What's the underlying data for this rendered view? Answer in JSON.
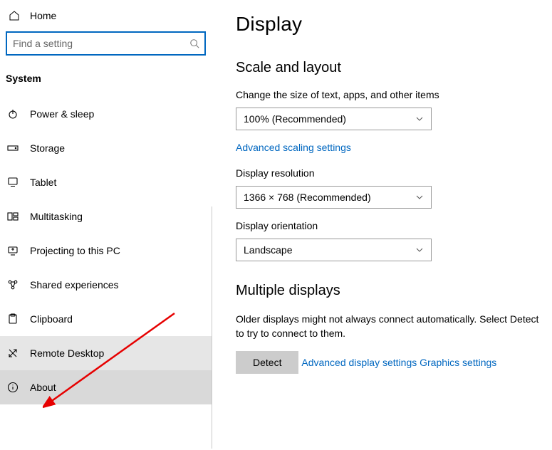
{
  "sidebar": {
    "home": "Home",
    "search_placeholder": "Find a setting",
    "category": "System",
    "items": [
      {
        "icon": "power-icon",
        "label": "Power & sleep"
      },
      {
        "icon": "storage-icon",
        "label": "Storage"
      },
      {
        "icon": "tablet-icon",
        "label": "Tablet"
      },
      {
        "icon": "multitasking-icon",
        "label": "Multitasking"
      },
      {
        "icon": "projecting-icon",
        "label": "Projecting to this PC"
      },
      {
        "icon": "shared-icon",
        "label": "Shared experiences"
      },
      {
        "icon": "clipboard-icon",
        "label": "Clipboard"
      },
      {
        "icon": "remote-desktop-icon",
        "label": "Remote Desktop"
      },
      {
        "icon": "about-icon",
        "label": "About"
      }
    ],
    "hover_index": 7,
    "selected_index": 8
  },
  "main": {
    "title": "Display",
    "scale_section": {
      "title": "Scale and layout",
      "size_label": "Change the size of text, apps, and other items",
      "size_value": "100% (Recommended)",
      "adv_scaling_link": "Advanced scaling settings",
      "resolution_label": "Display resolution",
      "resolution_value": "1366 × 768 (Recommended)",
      "orientation_label": "Display orientation",
      "orientation_value": "Landscape"
    },
    "multi_section": {
      "title": "Multiple displays",
      "desc": "Older displays might not always connect automatically. Select Detect to try to connect to them.",
      "detect_btn": "Detect",
      "adv_display_link": "Advanced display settings",
      "graphics_link": "Graphics settings"
    }
  }
}
